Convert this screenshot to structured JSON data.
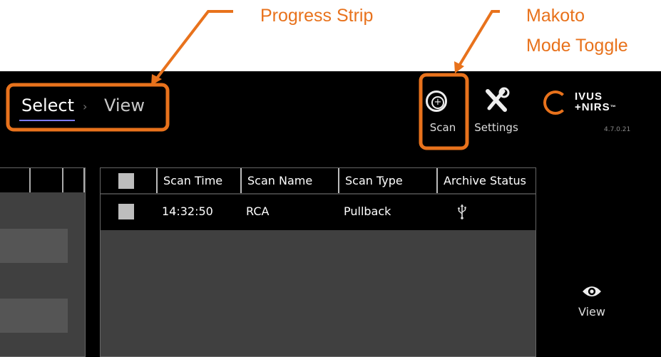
{
  "annotations": {
    "progress_strip": "Progress Strip",
    "makoto_line1": "Makoto",
    "makoto_line2": "Mode Toggle",
    "color": "#e8721c"
  },
  "breadcrumb": {
    "select": "Select",
    "separator": "›",
    "view": "View"
  },
  "toolbar": {
    "scan_label": "Scan",
    "scan_icon": "plus-circle-icon",
    "settings_label": "Settings",
    "settings_icon": "wrench-screwdriver-icon"
  },
  "logo": {
    "line1": "IVUS",
    "line2": "+NIRS",
    "tm": "™",
    "version": "4.7.0.21"
  },
  "scan_table": {
    "headers": [
      "Scan Time",
      "Scan Name",
      "Scan Type",
      "Archive Status"
    ],
    "rows": [
      {
        "time": "14:32:50",
        "name": "RCA",
        "type": "Pullback",
        "archive_icon": "usb-icon"
      }
    ]
  },
  "view_button": {
    "label": "View",
    "icon": "eye-icon"
  }
}
